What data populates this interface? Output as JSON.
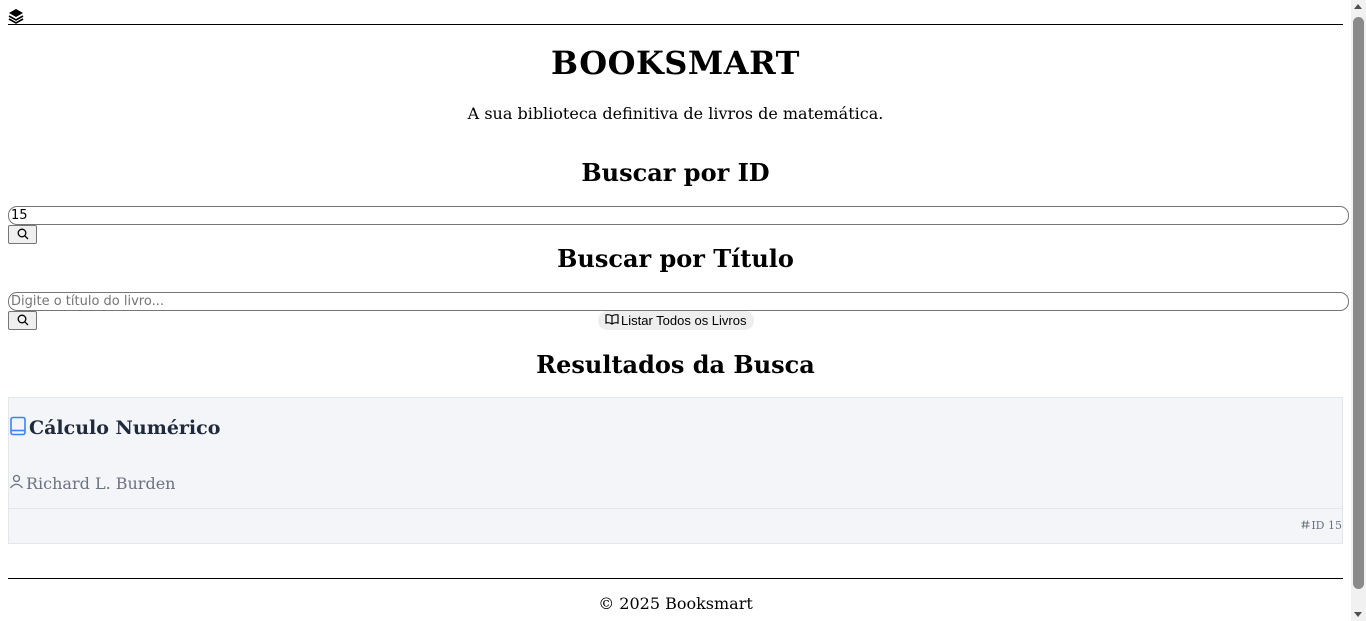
{
  "header": {
    "logo_icon": "books-icon"
  },
  "hero": {
    "title": "BOOKSMART",
    "tagline": "A sua biblioteca definitiva de livros de matemática."
  },
  "search_id": {
    "heading": "Buscar por ID",
    "value": "15",
    "button_icon": "search-icon"
  },
  "search_title": {
    "heading": "Buscar por Título",
    "placeholder": "Digite o título do livro...",
    "button_icon": "search-icon",
    "list_all_label": "Listar Todos os Livros",
    "list_all_icon": "open-book-icon"
  },
  "results": {
    "heading": "Resultados da Busca",
    "items": [
      {
        "title": "Cálculo Numérico",
        "author": "Richard L. Burden",
        "id_label": "ID 15",
        "title_icon": "book-icon",
        "author_icon": "user-icon",
        "id_icon": "hash-icon"
      }
    ]
  },
  "footer": {
    "copyright": "© 2025 Booksmart"
  },
  "colors": {
    "accent": "#3b82f6",
    "card_bg": "#f4f5f8",
    "muted": "#6b7280"
  }
}
